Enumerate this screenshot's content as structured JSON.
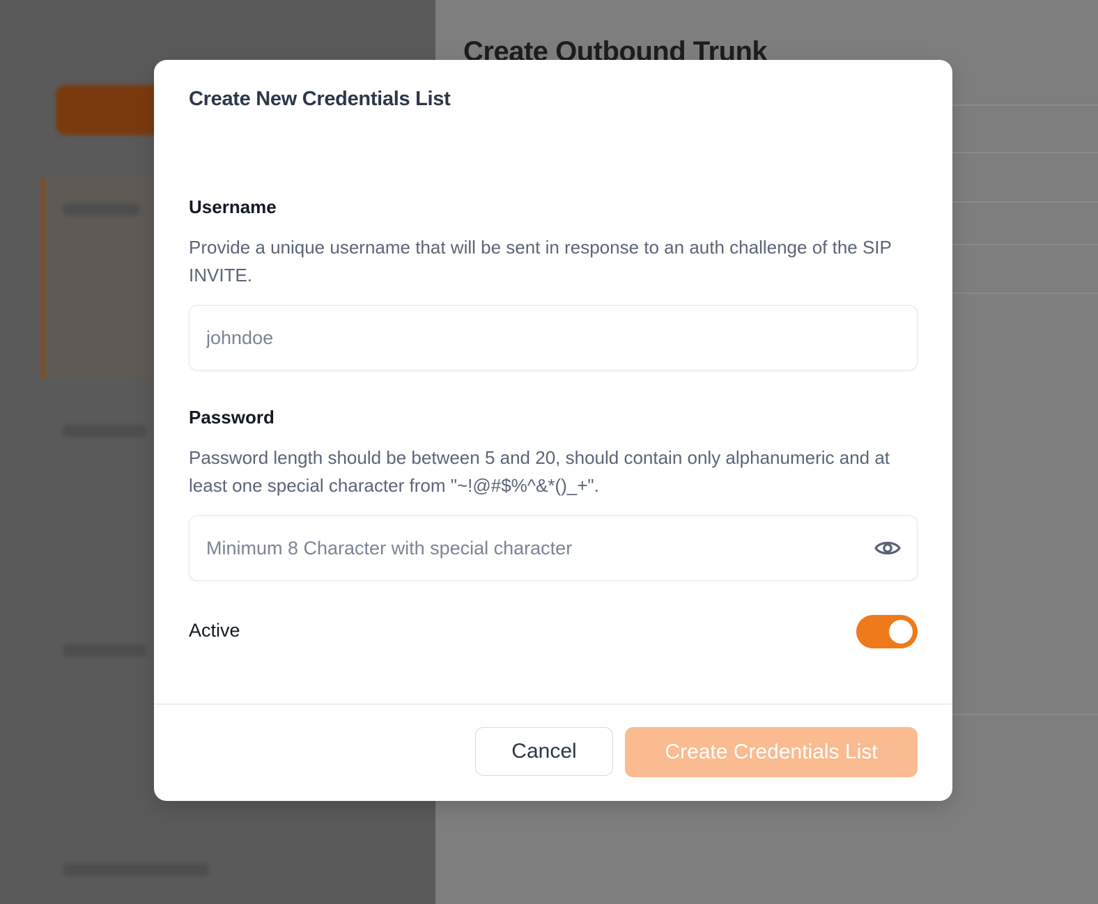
{
  "background": {
    "page_title": "Create Outbound Trunk"
  },
  "modal": {
    "title": "Create New Credentials List",
    "username": {
      "label": "Username",
      "description": "Provide a unique username that will be sent in response to an auth challenge of the SIP INVITE.",
      "placeholder": "johndoe",
      "value": ""
    },
    "password": {
      "label": "Password",
      "description": "Password length should be between 5 and 20, should contain only alphanumeric and at least one special character from \"~!@#$%^&*()_+\".",
      "placeholder": "Minimum 8 Character with special character",
      "value": "",
      "visibility_icon": "eye-icon"
    },
    "active": {
      "label": "Active",
      "enabled": true
    },
    "actions": {
      "cancel_label": "Cancel",
      "create_label": "Create Credentials List"
    }
  },
  "colors": {
    "accent": "#ee7a1c",
    "create_button_disabled": "#f9bb8f",
    "overlay": "#7e7e7e"
  }
}
